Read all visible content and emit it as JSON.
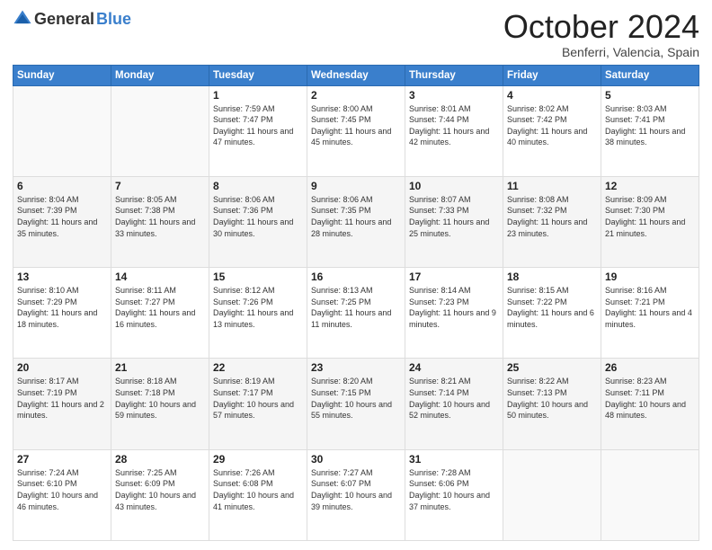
{
  "header": {
    "logo_general": "General",
    "logo_blue": "Blue",
    "month_title": "October 2024",
    "location": "Benferri, Valencia, Spain"
  },
  "weekdays": [
    "Sunday",
    "Monday",
    "Tuesday",
    "Wednesday",
    "Thursday",
    "Friday",
    "Saturday"
  ],
  "weeks": [
    [
      {
        "day": "",
        "sunrise": "",
        "sunset": "",
        "daylight": ""
      },
      {
        "day": "",
        "sunrise": "",
        "sunset": "",
        "daylight": ""
      },
      {
        "day": "1",
        "sunrise": "Sunrise: 7:59 AM",
        "sunset": "Sunset: 7:47 PM",
        "daylight": "Daylight: 11 hours and 47 minutes."
      },
      {
        "day": "2",
        "sunrise": "Sunrise: 8:00 AM",
        "sunset": "Sunset: 7:45 PM",
        "daylight": "Daylight: 11 hours and 45 minutes."
      },
      {
        "day": "3",
        "sunrise": "Sunrise: 8:01 AM",
        "sunset": "Sunset: 7:44 PM",
        "daylight": "Daylight: 11 hours and 42 minutes."
      },
      {
        "day": "4",
        "sunrise": "Sunrise: 8:02 AM",
        "sunset": "Sunset: 7:42 PM",
        "daylight": "Daylight: 11 hours and 40 minutes."
      },
      {
        "day": "5",
        "sunrise": "Sunrise: 8:03 AM",
        "sunset": "Sunset: 7:41 PM",
        "daylight": "Daylight: 11 hours and 38 minutes."
      }
    ],
    [
      {
        "day": "6",
        "sunrise": "Sunrise: 8:04 AM",
        "sunset": "Sunset: 7:39 PM",
        "daylight": "Daylight: 11 hours and 35 minutes."
      },
      {
        "day": "7",
        "sunrise": "Sunrise: 8:05 AM",
        "sunset": "Sunset: 7:38 PM",
        "daylight": "Daylight: 11 hours and 33 minutes."
      },
      {
        "day": "8",
        "sunrise": "Sunrise: 8:06 AM",
        "sunset": "Sunset: 7:36 PM",
        "daylight": "Daylight: 11 hours and 30 minutes."
      },
      {
        "day": "9",
        "sunrise": "Sunrise: 8:06 AM",
        "sunset": "Sunset: 7:35 PM",
        "daylight": "Daylight: 11 hours and 28 minutes."
      },
      {
        "day": "10",
        "sunrise": "Sunrise: 8:07 AM",
        "sunset": "Sunset: 7:33 PM",
        "daylight": "Daylight: 11 hours and 25 minutes."
      },
      {
        "day": "11",
        "sunrise": "Sunrise: 8:08 AM",
        "sunset": "Sunset: 7:32 PM",
        "daylight": "Daylight: 11 hours and 23 minutes."
      },
      {
        "day": "12",
        "sunrise": "Sunrise: 8:09 AM",
        "sunset": "Sunset: 7:30 PM",
        "daylight": "Daylight: 11 hours and 21 minutes."
      }
    ],
    [
      {
        "day": "13",
        "sunrise": "Sunrise: 8:10 AM",
        "sunset": "Sunset: 7:29 PM",
        "daylight": "Daylight: 11 hours and 18 minutes."
      },
      {
        "day": "14",
        "sunrise": "Sunrise: 8:11 AM",
        "sunset": "Sunset: 7:27 PM",
        "daylight": "Daylight: 11 hours and 16 minutes."
      },
      {
        "day": "15",
        "sunrise": "Sunrise: 8:12 AM",
        "sunset": "Sunset: 7:26 PM",
        "daylight": "Daylight: 11 hours and 13 minutes."
      },
      {
        "day": "16",
        "sunrise": "Sunrise: 8:13 AM",
        "sunset": "Sunset: 7:25 PM",
        "daylight": "Daylight: 11 hours and 11 minutes."
      },
      {
        "day": "17",
        "sunrise": "Sunrise: 8:14 AM",
        "sunset": "Sunset: 7:23 PM",
        "daylight": "Daylight: 11 hours and 9 minutes."
      },
      {
        "day": "18",
        "sunrise": "Sunrise: 8:15 AM",
        "sunset": "Sunset: 7:22 PM",
        "daylight": "Daylight: 11 hours and 6 minutes."
      },
      {
        "day": "19",
        "sunrise": "Sunrise: 8:16 AM",
        "sunset": "Sunset: 7:21 PM",
        "daylight": "Daylight: 11 hours and 4 minutes."
      }
    ],
    [
      {
        "day": "20",
        "sunrise": "Sunrise: 8:17 AM",
        "sunset": "Sunset: 7:19 PM",
        "daylight": "Daylight: 11 hours and 2 minutes."
      },
      {
        "day": "21",
        "sunrise": "Sunrise: 8:18 AM",
        "sunset": "Sunset: 7:18 PM",
        "daylight": "Daylight: 10 hours and 59 minutes."
      },
      {
        "day": "22",
        "sunrise": "Sunrise: 8:19 AM",
        "sunset": "Sunset: 7:17 PM",
        "daylight": "Daylight: 10 hours and 57 minutes."
      },
      {
        "day": "23",
        "sunrise": "Sunrise: 8:20 AM",
        "sunset": "Sunset: 7:15 PM",
        "daylight": "Daylight: 10 hours and 55 minutes."
      },
      {
        "day": "24",
        "sunrise": "Sunrise: 8:21 AM",
        "sunset": "Sunset: 7:14 PM",
        "daylight": "Daylight: 10 hours and 52 minutes."
      },
      {
        "day": "25",
        "sunrise": "Sunrise: 8:22 AM",
        "sunset": "Sunset: 7:13 PM",
        "daylight": "Daylight: 10 hours and 50 minutes."
      },
      {
        "day": "26",
        "sunrise": "Sunrise: 8:23 AM",
        "sunset": "Sunset: 7:11 PM",
        "daylight": "Daylight: 10 hours and 48 minutes."
      }
    ],
    [
      {
        "day": "27",
        "sunrise": "Sunrise: 7:24 AM",
        "sunset": "Sunset: 6:10 PM",
        "daylight": "Daylight: 10 hours and 46 minutes."
      },
      {
        "day": "28",
        "sunrise": "Sunrise: 7:25 AM",
        "sunset": "Sunset: 6:09 PM",
        "daylight": "Daylight: 10 hours and 43 minutes."
      },
      {
        "day": "29",
        "sunrise": "Sunrise: 7:26 AM",
        "sunset": "Sunset: 6:08 PM",
        "daylight": "Daylight: 10 hours and 41 minutes."
      },
      {
        "day": "30",
        "sunrise": "Sunrise: 7:27 AM",
        "sunset": "Sunset: 6:07 PM",
        "daylight": "Daylight: 10 hours and 39 minutes."
      },
      {
        "day": "31",
        "sunrise": "Sunrise: 7:28 AM",
        "sunset": "Sunset: 6:06 PM",
        "daylight": "Daylight: 10 hours and 37 minutes."
      },
      {
        "day": "",
        "sunrise": "",
        "sunset": "",
        "daylight": ""
      },
      {
        "day": "",
        "sunrise": "",
        "sunset": "",
        "daylight": ""
      }
    ]
  ]
}
